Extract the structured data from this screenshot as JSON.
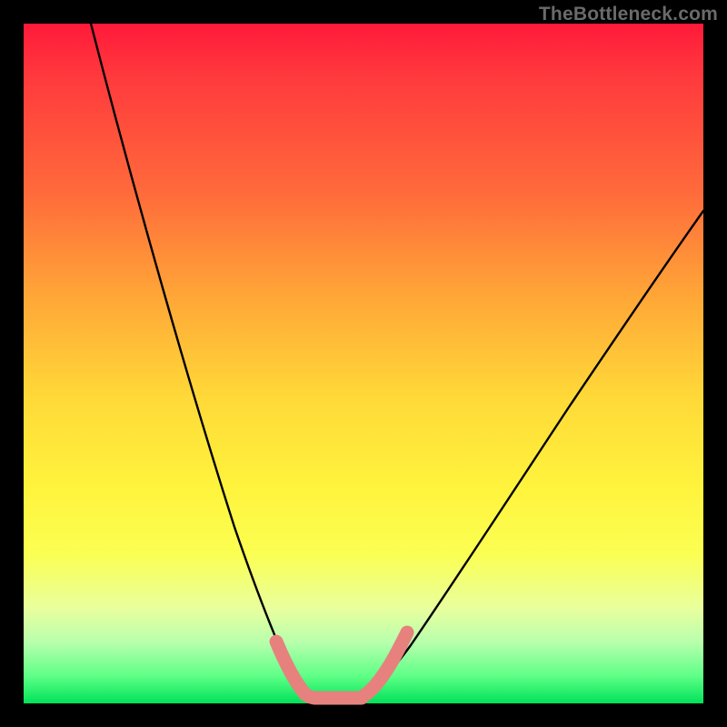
{
  "watermark": "TheBottleneck.com",
  "colors": {
    "frame": "#000000",
    "gradient_top": "#ff1a3a",
    "gradient_mid": "#fff33c",
    "gradient_bottom": "#00e259",
    "curve": "#000000",
    "highlight": "#e6817e"
  },
  "chart_data": {
    "type": "line",
    "title": "",
    "xlabel": "",
    "ylabel": "",
    "xlim": [
      0,
      100
    ],
    "ylim": [
      0,
      100
    ],
    "grid": false,
    "legend": false,
    "annotations": [],
    "description": "Two convex curves descending from left and right toward a flat minimum region near the bottom center, forming a V/U valley. Short coral highlight segments mark the near-valley portions of each curve and the flat minimum.",
    "series": [
      {
        "name": "left-curve",
        "x": [
          10,
          14,
          18,
          22,
          26,
          30,
          33,
          36,
          38,
          40
        ],
        "y": [
          100,
          85,
          69,
          53,
          38,
          24,
          14,
          7,
          3,
          1
        ]
      },
      {
        "name": "valley-floor",
        "x": [
          40,
          47
        ],
        "y": [
          1,
          1
        ]
      },
      {
        "name": "right-curve",
        "x": [
          47,
          52,
          58,
          64,
          72,
          80,
          88,
          96,
          100
        ],
        "y": [
          1,
          4,
          9,
          16,
          27,
          39,
          51,
          63,
          69
        ]
      }
    ],
    "highlights": [
      {
        "series": "left-curve",
        "x_from": 36,
        "x_to": 40
      },
      {
        "series": "valley-floor",
        "x_from": 40,
        "x_to": 47
      },
      {
        "series": "right-curve",
        "x_from": 47,
        "x_to": 52
      }
    ]
  }
}
